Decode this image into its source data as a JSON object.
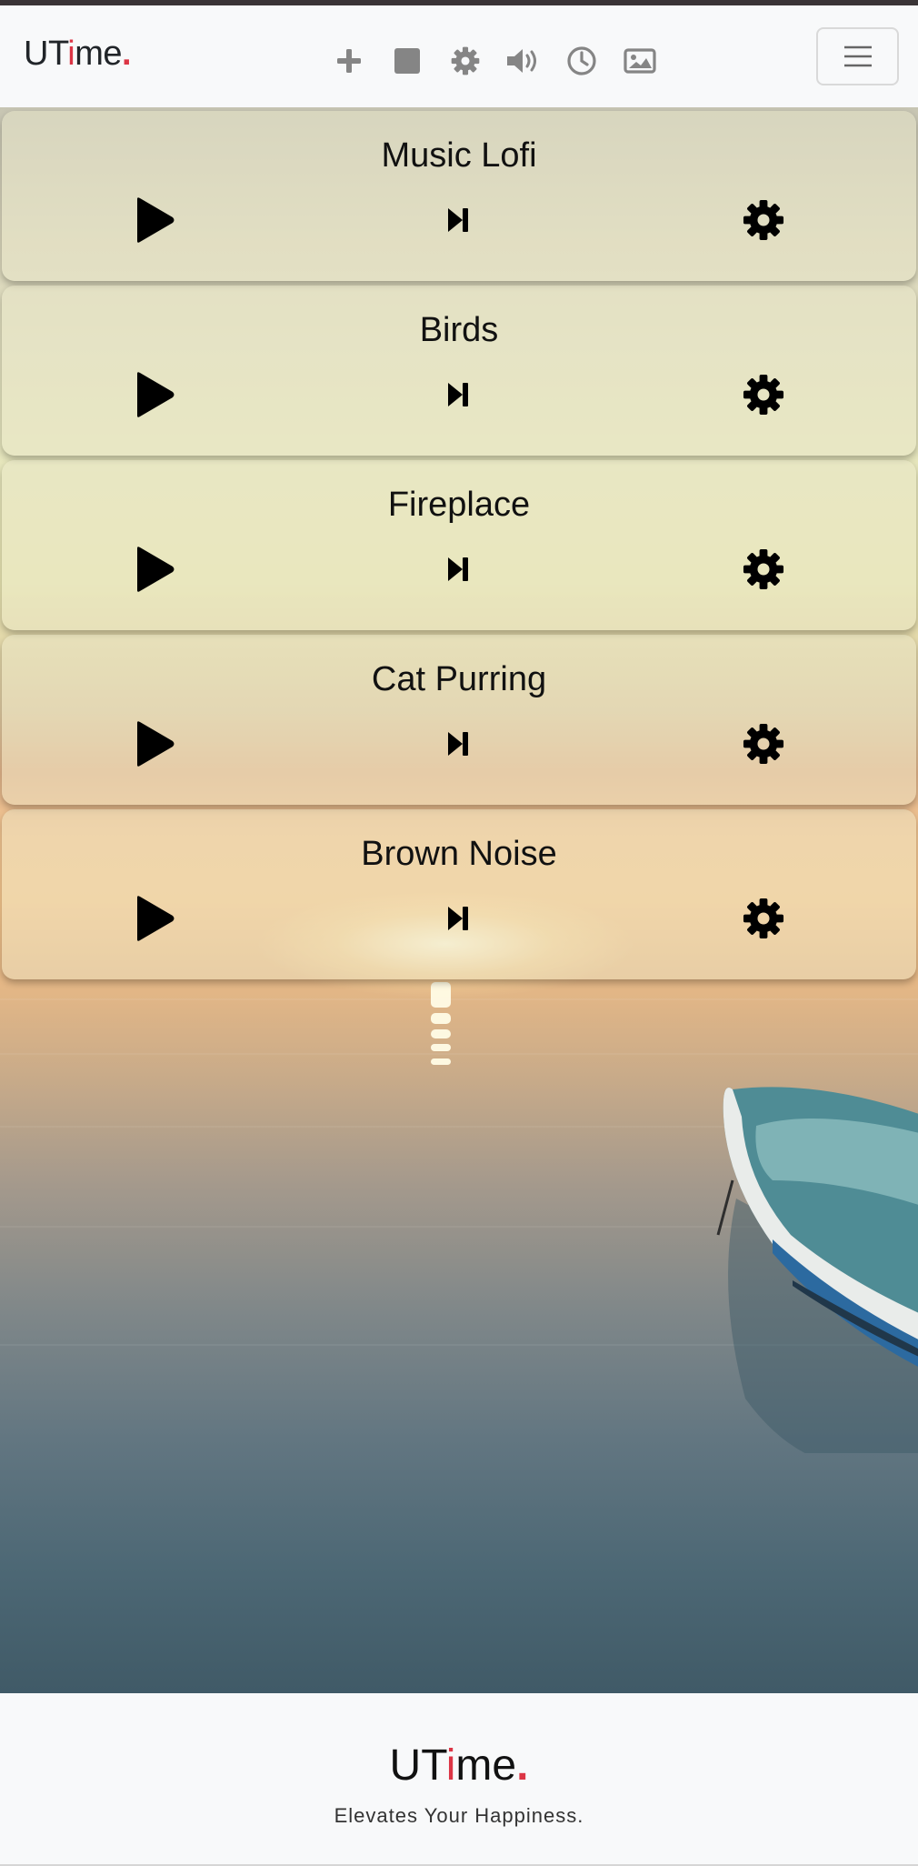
{
  "brand": {
    "prefix": "UT",
    "highlight": "i",
    "suffix": "me",
    "dot": ".",
    "accent_color": "#dc3545"
  },
  "navbar": {
    "icons": [
      "plus-icon",
      "stop-icon",
      "gear-icon",
      "volume-icon",
      "clock-icon",
      "image-icon"
    ],
    "menu_toggle_icon": "hamburger-icon"
  },
  "sounds": [
    {
      "title": "Music Lofi",
      "play_icon": "play-icon",
      "next_icon": "skip-next-icon",
      "settings_icon": "gear-icon"
    },
    {
      "title": "Birds",
      "play_icon": "play-icon",
      "next_icon": "skip-next-icon",
      "settings_icon": "gear-icon"
    },
    {
      "title": "Fireplace",
      "play_icon": "play-icon",
      "next_icon": "skip-next-icon",
      "settings_icon": "gear-icon"
    },
    {
      "title": "Cat Purring",
      "play_icon": "play-icon",
      "next_icon": "skip-next-icon",
      "settings_icon": "gear-icon"
    },
    {
      "title": "Brown Noise",
      "play_icon": "play-icon",
      "next_icon": "skip-next-icon",
      "settings_icon": "gear-icon"
    }
  ],
  "footer": {
    "brand": {
      "prefix": "UT",
      "highlight": "i",
      "suffix": "me",
      "dot": "."
    },
    "tagline": "Elevates Your Happiness."
  }
}
